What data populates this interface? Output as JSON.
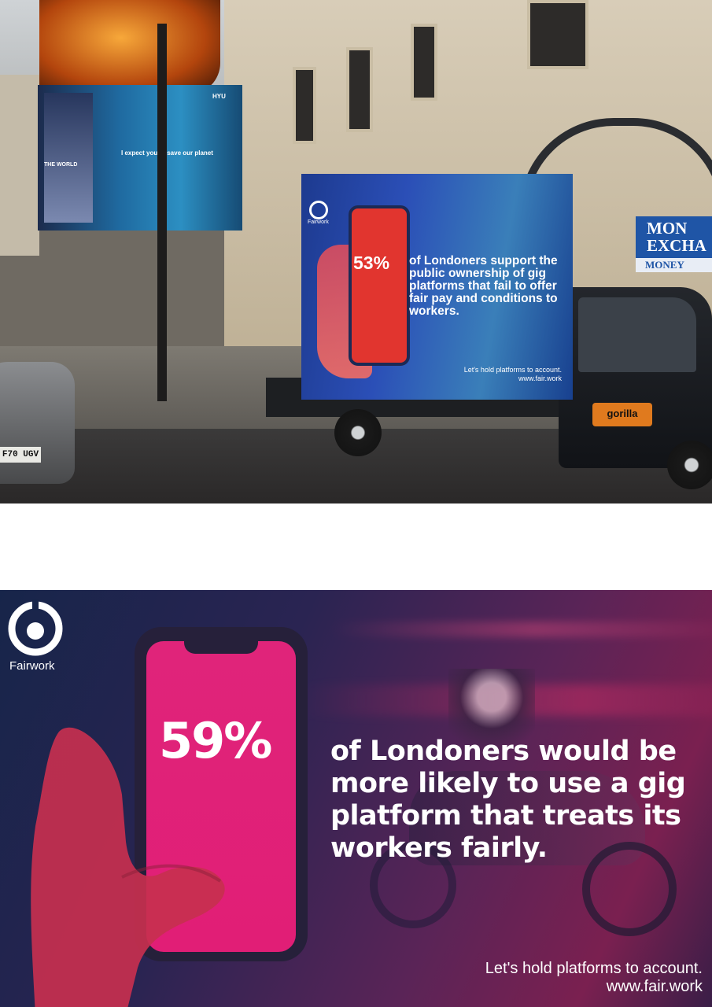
{
  "photo": {
    "screen_world_text": "THE WORLD",
    "screen_slogan": "I expect you to save our planet",
    "screen_brand": "HYU",
    "plate": "F70 UGV",
    "exchange_sign": "MON EXCHA",
    "exchange_money": "MONEY",
    "truck_brand": "gorilla",
    "billboard": {
      "logo_label": "Fairwork",
      "percentage": "53%",
      "message": "of Londoners support the public ownership of gig platforms that fail to offer fair pay and conditions to workers.",
      "footer_line1": "Let's hold platforms to account.",
      "footer_line2": "www.fair.work"
    }
  },
  "poster": {
    "logo_label": "Fairwork",
    "percentage": "59%",
    "message": "of Londoners would be more likely to use a gig platform that treats its workers fairly.",
    "footer_line1": "Let's hold platforms to account.",
    "footer_line2": "www.fair.work"
  },
  "colors": {
    "screen_pink": "#e11e76",
    "poster_navy": "#17254a",
    "billboard_blue": "#2b4fb7"
  },
  "icons": [
    "fairwork-logo-icon"
  ]
}
